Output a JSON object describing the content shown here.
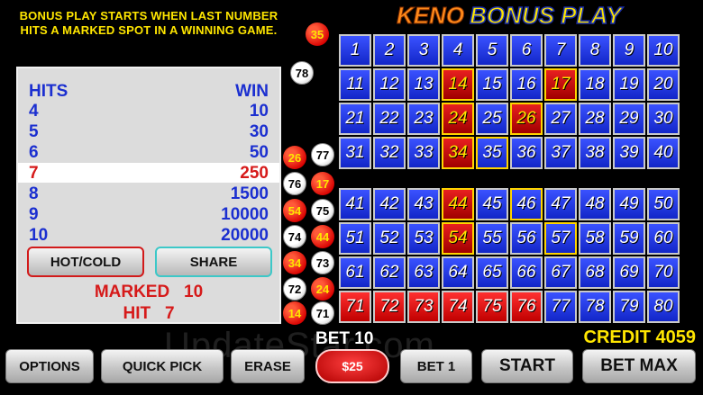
{
  "bonus_message": "BONUS PLAY STARTS WHEN LAST NUMBER HITS A MARKED SPOT IN A WINNING GAME.",
  "logo": {
    "keno": "KENO",
    "bonus": "BONUS PLAY"
  },
  "paytable": {
    "hits_header": "HITS",
    "win_header": "WIN",
    "rows": [
      {
        "hits": "4",
        "win": "10"
      },
      {
        "hits": "5",
        "win": "30"
      },
      {
        "hits": "6",
        "win": "50"
      },
      {
        "hits": "7",
        "win": "250"
      },
      {
        "hits": "8",
        "win": "1500"
      },
      {
        "hits": "9",
        "win": "10000"
      },
      {
        "hits": "10",
        "win": "20000"
      }
    ],
    "active_row": 3
  },
  "side_buttons": {
    "hot_cold": "HOT/COLD",
    "share": "SHARE"
  },
  "stats": {
    "marked_label": "MARKED",
    "marked": "10",
    "hit_label": "HIT",
    "hit": "7"
  },
  "drawn_balls": [
    {
      "n": "35",
      "color": "red"
    },
    {
      "n": "78",
      "color": "white"
    },
    {
      "n": "26",
      "color": "red"
    },
    {
      "n": "77",
      "color": "white"
    },
    {
      "n": "76",
      "color": "white"
    },
    {
      "n": "17",
      "color": "red"
    },
    {
      "n": "54",
      "color": "red"
    },
    {
      "n": "75",
      "color": "white"
    },
    {
      "n": "74",
      "color": "white"
    },
    {
      "n": "44",
      "color": "red"
    },
    {
      "n": "34",
      "color": "red"
    },
    {
      "n": "73",
      "color": "white"
    },
    {
      "n": "72",
      "color": "white"
    },
    {
      "n": "24",
      "color": "red"
    },
    {
      "n": "14",
      "color": "red"
    },
    {
      "n": "71",
      "color": "white"
    }
  ],
  "board": {
    "marked": [
      14,
      17,
      24,
      26,
      34,
      35,
      44,
      46,
      54,
      57
    ],
    "hits": [
      14,
      17,
      24,
      26,
      34,
      44,
      54
    ],
    "red_drawn": [
      71,
      72,
      73,
      74,
      75,
      76
    ]
  },
  "bet_label": "BET 10",
  "credit_label": "CREDIT 4059",
  "buttons": {
    "options": "OPTIONS",
    "quick_pick": "QUICK PICK",
    "erase": "ERASE",
    "denom": "$25",
    "bet_one": "BET 1",
    "start": "START",
    "bet_max": "BET MAX"
  },
  "watermark": "UpdateStar.com",
  "colors": {
    "accent_yellow": "#ffe600",
    "cell_blue": "#1f36e8",
    "hit_red": "#d61a1a"
  }
}
